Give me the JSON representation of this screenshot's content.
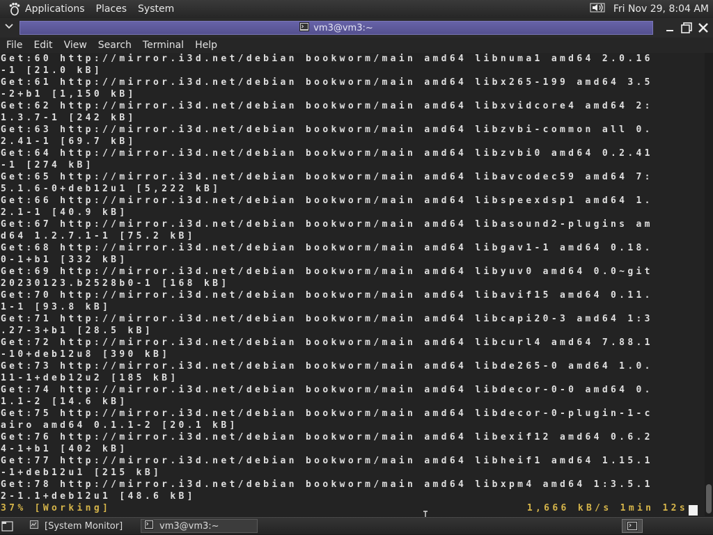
{
  "top_panel": {
    "menus": [
      "Applications",
      "Places",
      "System"
    ],
    "clock": "Fri Nov 29,  8:04 AM"
  },
  "window": {
    "title": "vm3@vm3:~"
  },
  "menubar": [
    "File",
    "Edit",
    "View",
    "Search",
    "Terminal",
    "Help"
  ],
  "terminal": {
    "lines": [
      "Get:60 http://mirror.i3d.net/debian bookworm/main amd64 libnuma1 amd64 2.0.16",
      "-1 [21.0 kB]",
      "Get:61 http://mirror.i3d.net/debian bookworm/main amd64 libx265-199 amd64 3.5",
      "-2+b1 [1,150 kB]",
      "Get:62 http://mirror.i3d.net/debian bookworm/main amd64 libxvidcore4 amd64 2:",
      "1.3.7-1 [242 kB]",
      "Get:63 http://mirror.i3d.net/debian bookworm/main amd64 libzvbi-common all 0.",
      "2.41-1 [69.7 kB]",
      "Get:64 http://mirror.i3d.net/debian bookworm/main amd64 libzvbi0 amd64 0.2.41",
      "-1 [274 kB]",
      "Get:65 http://mirror.i3d.net/debian bookworm/main amd64 libavcodec59 amd64 7:",
      "5.1.6-0+deb12u1 [5,222 kB]",
      "Get:66 http://mirror.i3d.net/debian bookworm/main amd64 libspeexdsp1 amd64 1.",
      "2.1-1 [40.9 kB]",
      "Get:67 http://mirror.i3d.net/debian bookworm/main amd64 libasound2-plugins am",
      "d64 1.2.7.1-1 [75.2 kB]",
      "Get:68 http://mirror.i3d.net/debian bookworm/main amd64 libgav1-1 amd64 0.18.",
      "0-1+b1 [332 kB]",
      "Get:69 http://mirror.i3d.net/debian bookworm/main amd64 libyuv0 amd64 0.0~git",
      "20230123.b2528b0-1 [168 kB]",
      "Get:70 http://mirror.i3d.net/debian bookworm/main amd64 libavif15 amd64 0.11.",
      "1-1 [93.8 kB]",
      "Get:71 http://mirror.i3d.net/debian bookworm/main amd64 libcapi20-3 amd64 1:3",
      ".27-3+b1 [28.5 kB]",
      "Get:72 http://mirror.i3d.net/debian bookworm/main amd64 libcurl4 amd64 7.88.1",
      "-10+deb12u8 [390 kB]",
      "Get:73 http://mirror.i3d.net/debian bookworm/main amd64 libde265-0 amd64 1.0.",
      "11-1+deb12u2 [185 kB]",
      "Get:74 http://mirror.i3d.net/debian bookworm/main amd64 libdecor-0-0 amd64 0.",
      "1.1-2 [14.6 kB]",
      "Get:75 http://mirror.i3d.net/debian bookworm/main amd64 libdecor-0-plugin-1-c",
      "airo amd64 0.1.1-2 [20.1 kB]",
      "Get:76 http://mirror.i3d.net/debian bookworm/main amd64 libexif12 amd64 0.6.2",
      "4-1+b1 [402 kB]",
      "Get:77 http://mirror.i3d.net/debian bookworm/main amd64 libheif1 amd64 1.15.1",
      "-1+deb12u1 [215 kB]",
      "Get:78 http://mirror.i3d.net/debian bookworm/main amd64 libxpm4 amd64 1:3.5.1",
      "2-1.1+deb12u1 [48.6 kB]"
    ],
    "status_left": "37% [Working]",
    "status_right": "1,666 kB/s 1min 12s"
  },
  "taskbar": {
    "tasks": [
      "[System Monitor]",
      "vm3@vm3:~"
    ]
  },
  "icons": {
    "foot": "gnome-foot-icon",
    "volume": "volume-icon",
    "terminal": "terminal-icon",
    "system_monitor": "system-monitor-icon",
    "show_desktop": "show-desktop-icon",
    "workspace": "workspace-switcher-icon"
  },
  "colors": {
    "terminal_bg": "#232323",
    "terminal_fg": "#e0e0e0",
    "status_fg": "#d6b54a",
    "title_bar": "#5d5a9c"
  }
}
